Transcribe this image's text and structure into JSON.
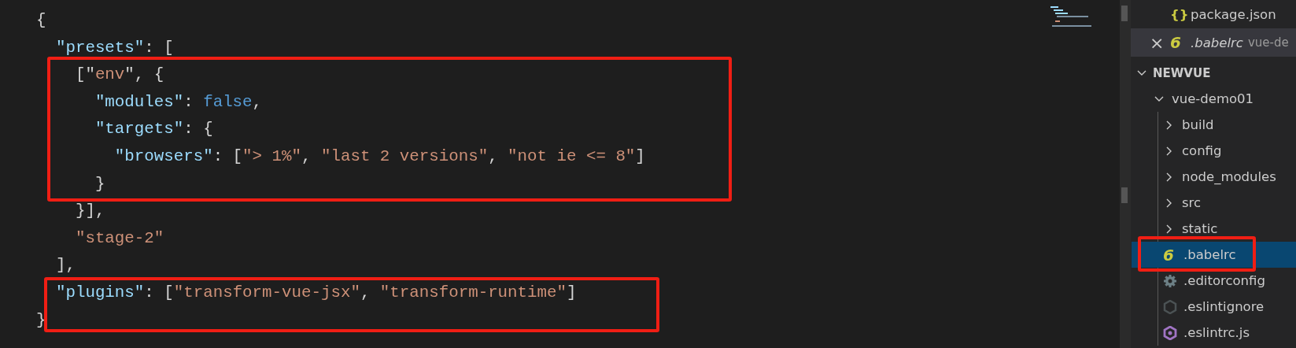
{
  "editor": {
    "lines": [
      [
        {
          "kind": "punct",
          "text": "{"
        }
      ],
      [
        {
          "kind": "key",
          "text": "  \"presets\""
        },
        {
          "kind": "punct",
          "text": ": ["
        }
      ],
      [
        {
          "kind": "punct",
          "text": "    [\""
        },
        {
          "kind": "string",
          "text": "env"
        },
        {
          "kind": "punct",
          "text": "\", {"
        }
      ],
      [
        {
          "kind": "key",
          "text": "      \"modules\""
        },
        {
          "kind": "punct",
          "text": ": "
        },
        {
          "kind": "keyword",
          "text": "false"
        },
        {
          "kind": "punct",
          "text": ","
        }
      ],
      [
        {
          "kind": "key",
          "text": "      \"targets\""
        },
        {
          "kind": "punct",
          "text": ": {"
        }
      ],
      [
        {
          "kind": "key",
          "text": "        \"browsers\""
        },
        {
          "kind": "punct",
          "text": ": ["
        },
        {
          "kind": "string",
          "text": "\"> 1%\""
        },
        {
          "kind": "punct",
          "text": ", "
        },
        {
          "kind": "string",
          "text": "\"last 2 versions\""
        },
        {
          "kind": "punct",
          "text": ", "
        },
        {
          "kind": "string",
          "text": "\"not ie <= 8\""
        },
        {
          "kind": "punct",
          "text": "]"
        }
      ],
      [
        {
          "kind": "punct",
          "text": "      }"
        }
      ],
      [
        {
          "kind": "punct",
          "text": "    }],"
        }
      ],
      [
        {
          "kind": "string",
          "text": "    \"stage-2\""
        }
      ],
      [
        {
          "kind": "punct",
          "text": "  ],"
        }
      ],
      [
        {
          "kind": "key",
          "text": "  \"plugins\""
        },
        {
          "kind": "punct",
          "text": ": ["
        },
        {
          "kind": "string",
          "text": "\"transform-vue-jsx\""
        },
        {
          "kind": "punct",
          "text": ", "
        },
        {
          "kind": "string",
          "text": "\"transform-runtime\""
        },
        {
          "kind": "punct",
          "text": "]"
        }
      ],
      [
        {
          "kind": "punct",
          "text": "}"
        }
      ]
    ]
  },
  "open_editors": [
    {
      "icon": "{}",
      "name": "package.json",
      "selected": false
    },
    {
      "icon": "6",
      "name": ".babelrc",
      "description": "vue-de",
      "selected": true,
      "close": "×"
    }
  ],
  "explorer": {
    "title": "NEWVUE",
    "expanded": true,
    "children": [
      {
        "name": "vue-demo01",
        "kind": "folder",
        "expanded": true,
        "children": [
          {
            "name": "build",
            "kind": "folder",
            "expanded": false,
            "selected": false
          },
          {
            "name": "config",
            "kind": "folder",
            "expanded": false,
            "selected": false
          },
          {
            "name": "node_modules",
            "kind": "folder",
            "expanded": false,
            "selected": false
          },
          {
            "name": "src",
            "kind": "folder",
            "expanded": false,
            "selected": false
          },
          {
            "name": "static",
            "kind": "folder",
            "expanded": false,
            "selected": false
          },
          {
            "name": ".babelrc",
            "kind": "babel",
            "icon": "6",
            "selected": true
          },
          {
            "name": ".editorconfig",
            "kind": "gear",
            "selected": false
          },
          {
            "name": ".eslintignore",
            "kind": "hexagon",
            "selected": false
          },
          {
            "name": ".eslintrc.js",
            "kind": "eslint",
            "selected": false
          }
        ]
      }
    ]
  }
}
